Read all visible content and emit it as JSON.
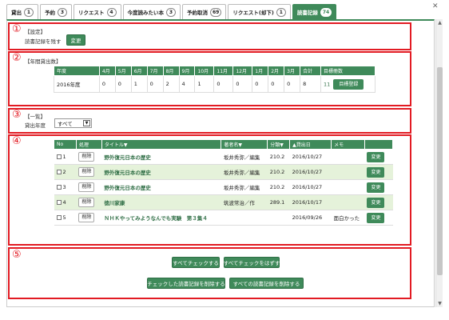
{
  "tabs": [
    {
      "label": "貸出",
      "count": "1"
    },
    {
      "label": "予約",
      "count": "3"
    },
    {
      "label": "リクエスト",
      "count": "4"
    },
    {
      "label": "今度読みたい本",
      "count": "3"
    },
    {
      "label": "予約取消",
      "count": "69"
    },
    {
      "label": "リクエスト(却下)",
      "count": "1"
    },
    {
      "label": "読書記録",
      "count": "74"
    }
  ],
  "markers": [
    "①",
    "②",
    "③",
    "④",
    "⑤"
  ],
  "settings": {
    "heading": "【設定】",
    "keep_label": "読書記録を残す",
    "change_button": "変更"
  },
  "annual": {
    "heading": "【年間貸出数】",
    "headers": [
      "年度",
      "4月",
      "5月",
      "6月",
      "7月",
      "8月",
      "9月",
      "10月",
      "11月",
      "12月",
      "1月",
      "2月",
      "3月",
      "合計",
      "目標冊数"
    ],
    "row": [
      "2016年度",
      "0",
      "0",
      "1",
      "0",
      "2",
      "4",
      "1",
      "0",
      "0",
      "0",
      "0",
      "0",
      "8"
    ],
    "goal_value": "11",
    "goal_button": "目標登録"
  },
  "list_filter": {
    "heading": "【一覧】",
    "year_label": "貸出年度",
    "year_value": "すべて"
  },
  "list": {
    "headers": [
      "No",
      "処理",
      "タイトル",
      "著者名",
      "分類",
      "貸出日",
      "メモ",
      ""
    ],
    "delete_label": "削除",
    "edit_label": "変更",
    "rows": [
      {
        "no": "1",
        "title": "野外復元日本の歴史",
        "author": "坂井秀弥／編集",
        "class": "210.2",
        "date": "2016/10/27",
        "memo": ""
      },
      {
        "no": "2",
        "title": "野外復元日本の歴史",
        "author": "坂井秀弥／編集",
        "class": "210.2",
        "date": "2016/10/27",
        "memo": ""
      },
      {
        "no": "3",
        "title": "野外復元日本の歴史",
        "author": "坂井秀弥／編集",
        "class": "210.2",
        "date": "2016/10/27",
        "memo": ""
      },
      {
        "no": "4",
        "title": "徳川家康",
        "author": "筑波常治／作",
        "class": "289.1",
        "date": "2016/10/17",
        "memo": ""
      },
      {
        "no": "5",
        "title": "ＮＨＫやってみようなんでも実験　第３集４",
        "author": "",
        "class": "",
        "date": "2016/09/26",
        "memo": "面白かった"
      }
    ]
  },
  "actions": {
    "check_all": "すべてチェックする",
    "uncheck_all": "すべてチェックをはずす",
    "delete_checked": "チェックした読書記録を削除する",
    "delete_all": "すべての読書記録を削除する"
  }
}
